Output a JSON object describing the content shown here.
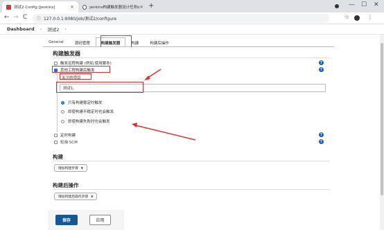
{
  "browser": {
    "tabs": [
      {
        "title": "测试2 Config [Jenkins]",
        "close": "×"
      },
      {
        "title": "jenkins构建触发器设计任务build…",
        "close": "×"
      }
    ],
    "new_tab": "+",
    "url": "127.0.0.1:9080/job/测试2/configure",
    "back": "←",
    "forward": "→",
    "reload": "C",
    "star": "☆",
    "menu": "⋮",
    "win_min": "—",
    "win_max": "☐",
    "win_close": "✕"
  },
  "jenkins": {
    "breadcrumb_root": "Dashboard",
    "breadcrumb_sep": "›",
    "breadcrumb_job": "测试2",
    "breadcrumb_sep2": "›"
  },
  "config_tabs": [
    {
      "label": "General"
    },
    {
      "label": "源码管理"
    },
    {
      "label": "构建触发器"
    },
    {
      "label": "构建"
    },
    {
      "label": "构建后操作"
    }
  ],
  "triggers": {
    "heading": "构建触发器",
    "options": [
      {
        "label": "触发远程构建 (例如,使用脚本)",
        "checked": false
      },
      {
        "label": "其他工程构建后触发",
        "checked": true
      }
    ],
    "projects_label": "关注的项目",
    "projects_value": "测试1,",
    "radios": [
      {
        "label": "只有构建稳定时触发",
        "checked": true
      },
      {
        "label": "即使构建不稳定时也会触发",
        "checked": false
      },
      {
        "label": "即使构建失败时也会触发",
        "checked": false
      }
    ],
    "more_options": [
      {
        "label": "定时构建",
        "checked": false
      },
      {
        "label": "轮询 SCM",
        "checked": false
      }
    ],
    "help": "?"
  },
  "build": {
    "heading": "构建",
    "add_step": "增加构建步骤"
  },
  "post_build": {
    "heading": "构建后操作",
    "add_step": "增加构建后操作步骤"
  },
  "actions": {
    "save": "保存",
    "apply": "应用"
  },
  "colors": {
    "accent": "#2a6fd6",
    "primary_button": "#155896",
    "annotation": "#e0302e",
    "help_icon": "#1c5eb6"
  }
}
